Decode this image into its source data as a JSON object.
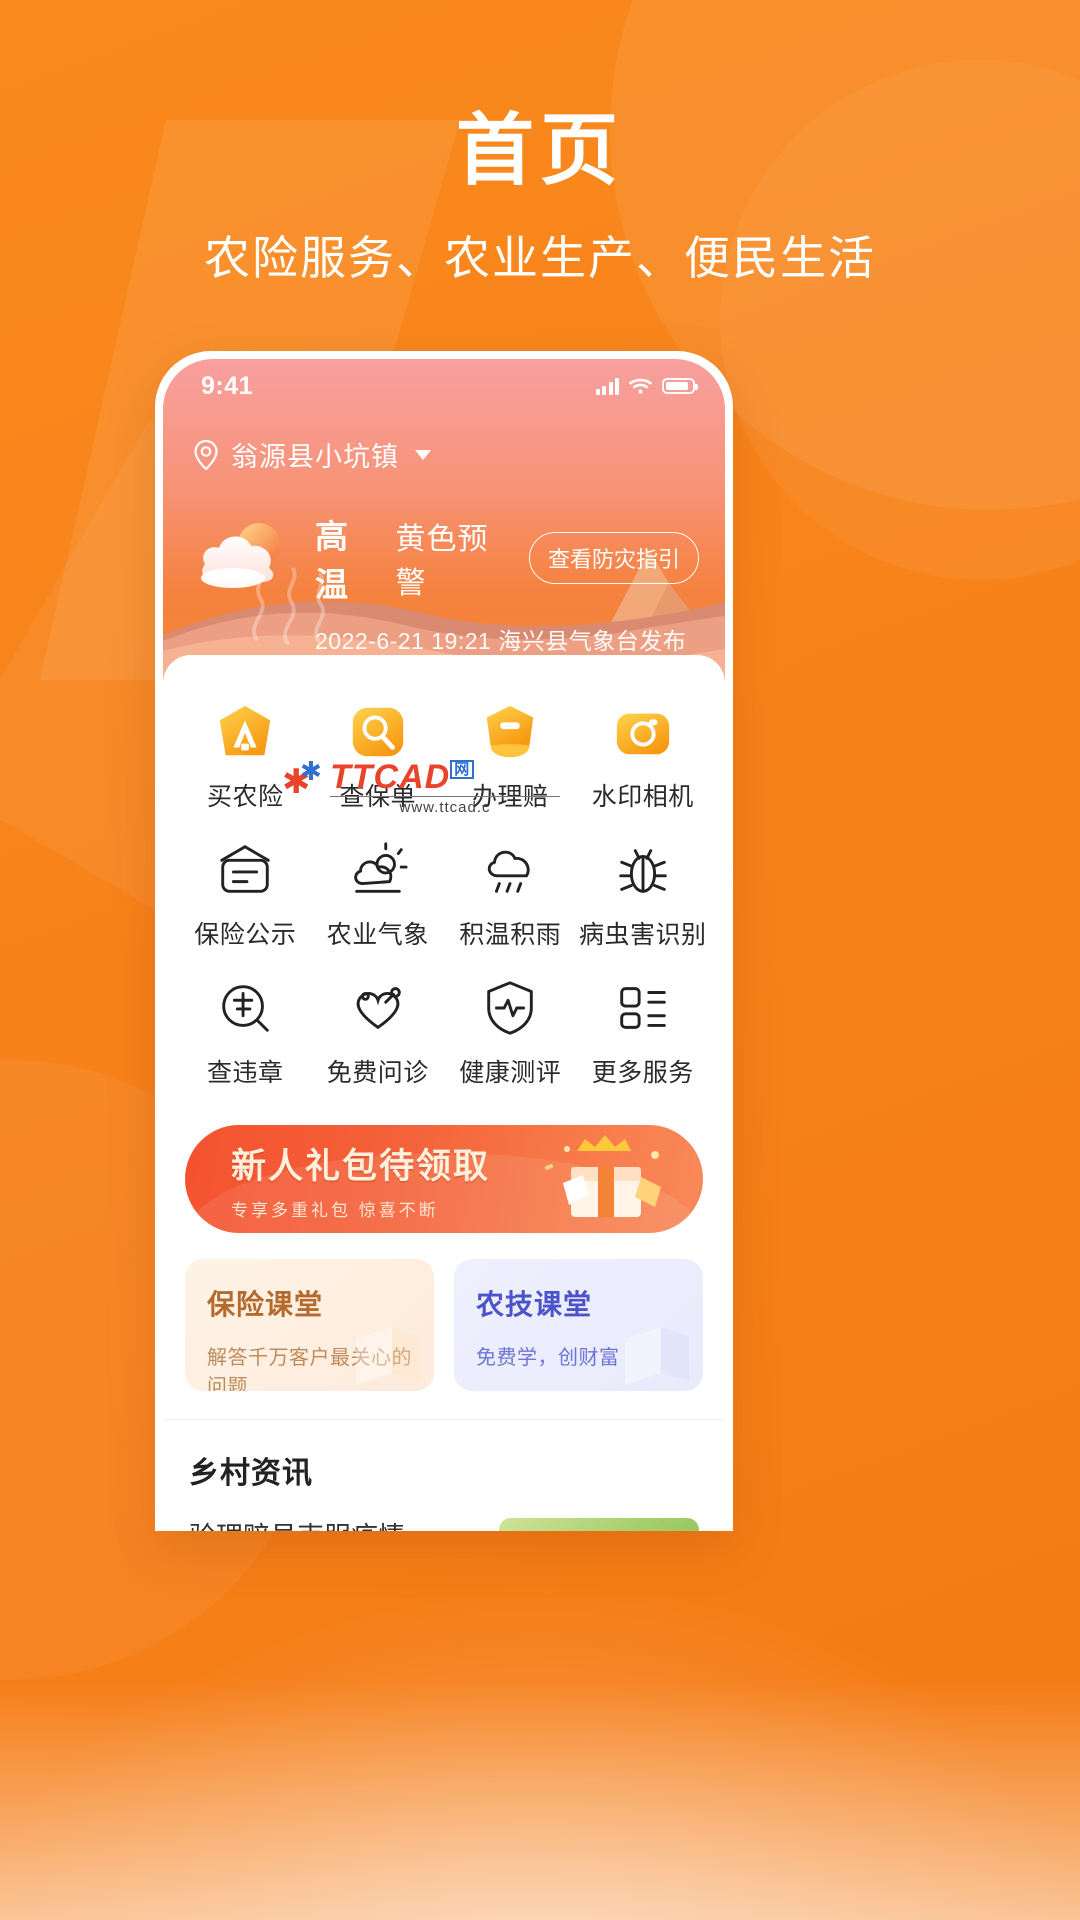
{
  "poster": {
    "title": "首页",
    "subtitle": "农险服务、农业生产、便民生活",
    "bg_color": "#F7821B"
  },
  "phone": {
    "status_bar": {
      "time": "9:41",
      "signal_icon": "signal-bars-icon",
      "wifi_icon": "wifi-icon",
      "battery_icon": "battery-icon"
    },
    "location": {
      "pin_icon": "location-pin-icon",
      "name": "翁源县小坑镇",
      "caret_icon": "chevron-down-icon"
    },
    "weather_alert": {
      "icon": "sun-behind-cloud-icon",
      "type": "高温",
      "level": "黄色预警",
      "action_label": "查看防灾指引",
      "meta": "2022-6-21 19:21 海兴县气象台发布"
    },
    "grid": [
      {
        "label": "买农险",
        "icon": "shield-insurance-icon",
        "style": "gold"
      },
      {
        "label": "查保单",
        "icon": "search-policy-icon",
        "style": "gold"
      },
      {
        "label": "办理赔",
        "icon": "claim-document-icon",
        "style": "gold"
      },
      {
        "label": "水印相机",
        "icon": "camera-watermark-icon",
        "style": "gold"
      },
      {
        "label": "保险公示",
        "icon": "announcement-board-icon",
        "style": "line"
      },
      {
        "label": "农业气象",
        "icon": "weather-sun-cloud-icon",
        "style": "line"
      },
      {
        "label": "积温积雨",
        "icon": "rain-cloud-icon",
        "style": "line"
      },
      {
        "label": "病虫害识别",
        "icon": "insect-pest-icon",
        "style": "line"
      },
      {
        "label": "查违章",
        "icon": "traffic-violation-icon",
        "style": "line"
      },
      {
        "label": "免费问诊",
        "icon": "heart-stethoscope-icon",
        "style": "line"
      },
      {
        "label": "健康测评",
        "icon": "shield-heartbeat-icon",
        "style": "line"
      },
      {
        "label": "更多服务",
        "icon": "grid-more-icon",
        "style": "line"
      }
    ],
    "gift_banner": {
      "title": "新人礼包待领取",
      "subtitle": "专享多重礼包 惊喜不断",
      "art_icon": "gift-box-crown-icon",
      "color": "#F5522F"
    },
    "courses": [
      {
        "title": "保险课堂",
        "desc": "解答千万客户最关心的问题",
        "title_color": "#B46A2C",
        "bg_color": "#FEF3E6"
      },
      {
        "title": "农技课堂",
        "desc": "免费学，创财富",
        "title_color": "#4B53C8",
        "bg_color": "#EFF0FE"
      }
    ],
    "news": {
      "heading": "乡村资讯",
      "item_text": "验理赔员克服疫情",
      "thumb_icon": "vegetable-photo"
    }
  },
  "watermark": {
    "brand_tt": "TTCAD",
    "brand_box": "网",
    "url": "www.ttcad.c"
  }
}
